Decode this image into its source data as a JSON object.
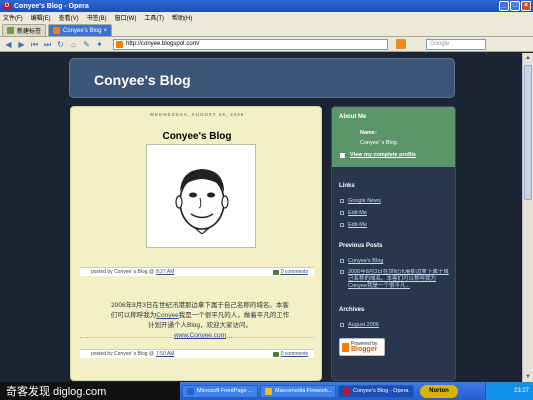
{
  "window": {
    "title": "Conyee's Blog - Opera"
  },
  "menu": [
    "文件(F)",
    "编辑(E)",
    "查看(V)",
    "书签(B)",
    "窗口(W)",
    "工具(T)",
    "帮助(H)"
  ],
  "tabs": [
    {
      "label": "新建标签"
    },
    {
      "label": "Conyee's Blog"
    }
  ],
  "address": {
    "url": "http://conyee.blogspot.com/",
    "search_placeholder": "Google"
  },
  "blog": {
    "header_title": "Conyee's Blog",
    "post1": {
      "date": "WEDNESDAY, AUGUST 09, 2006",
      "title": "Conyee's Blog",
      "footer_prefix": "posted by Conyee' s Blog @",
      "time": "8:27 AM",
      "comments": "0 comments"
    },
    "post2": {
      "body_line1": "2006年8月3日在世纪汛港那边拿下属于自己名称的域名。本客",
      "body_line2_pre": "们可以称呼我为",
      "body_line2_link": "Conyee",
      "body_line2_post": "我是一个很平凡的人，做着平凡的工作",
      "body_line3": "计划开通个人Blog，欢迎大家访问。",
      "body_link": "www.Conyee.com",
      "footer_prefix": "posted by Conyee' s Blog @",
      "time": "7:50 AM",
      "comments": "0 comments"
    },
    "sidebar": {
      "about_heading": "About Me",
      "name_label": "Name:",
      "name_value": "Conyee' s Blog",
      "profile_link": "View my complete profile",
      "links_heading": "Links",
      "links": [
        "Google News",
        "Edit-Me",
        "Edit-Me"
      ],
      "previous_heading": "Previous Posts",
      "previous": [
        "Conyee's Blog",
        "2006年8月3日在世纪汛港那边拿下属于自己名称的域名。本客们可以称呼我为Conyee我是一个很平凡..."
      ],
      "archives_heading": "Archives",
      "archives": [
        "August 2006"
      ],
      "badge_line1": "Powered by",
      "badge_line2": "Blogger"
    }
  },
  "taskbar": {
    "watermark": "奇客发现 diglog.com",
    "items": [
      {
        "label": "Microsoft FrontPage ...",
        "color": "#2a64c4"
      },
      {
        "label": "Macromedia Firework...",
        "color": "#f5c000"
      },
      {
        "label": "Conyee's Blog - Opera",
        "color": "#c8102e"
      }
    ],
    "norton": "Norton",
    "clock": "23:27"
  },
  "colors": {
    "header_bg": "#3a5575",
    "main_bg": "#f2f0c5",
    "about_bg": "#5b9569",
    "page_bg": "#1a2433"
  }
}
